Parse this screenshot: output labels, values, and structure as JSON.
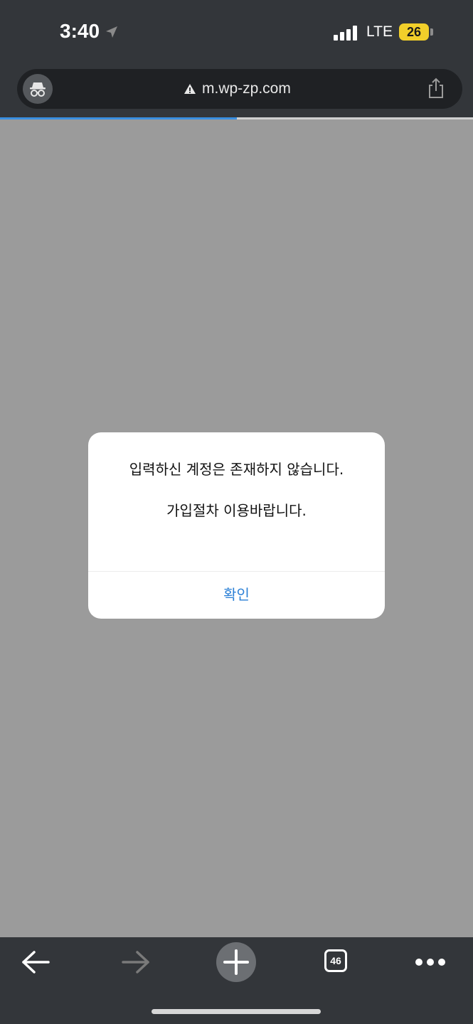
{
  "status_bar": {
    "time": "3:40",
    "network": "LTE",
    "battery": "26",
    "battery_color": "#f2cf2a",
    "signal_bars": 4
  },
  "browser": {
    "mode": "incognito",
    "url": "m.wp-zp.com",
    "security_icon": "warning-triangle-icon",
    "load_progress": 0.5,
    "progress_color": "#3a8fe0"
  },
  "dialog": {
    "message_line1": "입력하신 계정은 존재하지 않습니다.",
    "message_line2": "가입절차 이용바랍니다.",
    "confirm_label": "확인",
    "button_color": "#2a7fd6"
  },
  "toolbar": {
    "back_icon": "back-arrow-icon",
    "forward_icon": "forward-arrow-icon",
    "new_tab_icon": "plus-icon",
    "tab_count": "46",
    "menu_icon": "more-dots-icon"
  }
}
